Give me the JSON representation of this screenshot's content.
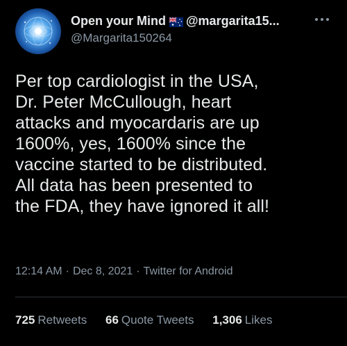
{
  "user": {
    "display_name": "Open your Mind",
    "flag_icon": "australia-flag-icon",
    "handle_inline": "@margarita15...",
    "handle": "@Margarita150264",
    "avatar_icon": "globe-brain-avatar"
  },
  "tweet": {
    "text": "Per top cardiologist in the USA,\nDr. Peter McCullough, heart\nattacks and myocardaris are up\n1600%, yes, 1600%  since the\nvaccine started to be distributed.\nAll data has been presented to\nthe FDA, they have ignored it all!"
  },
  "meta": {
    "time": "12:14 AM",
    "date": "Dec 8, 2021",
    "source": "Twitter for Android",
    "separator": "·"
  },
  "stats": {
    "retweets_count": "725",
    "retweets_label": "Retweets",
    "quotes_count": "66",
    "quotes_label": "Quote Tweets",
    "likes_count": "1,306",
    "likes_label": "Likes"
  },
  "colors": {
    "background": "#000000",
    "text_primary": "#e7e9ea",
    "text_secondary": "#8b98a5",
    "divider": "#2f3336"
  }
}
